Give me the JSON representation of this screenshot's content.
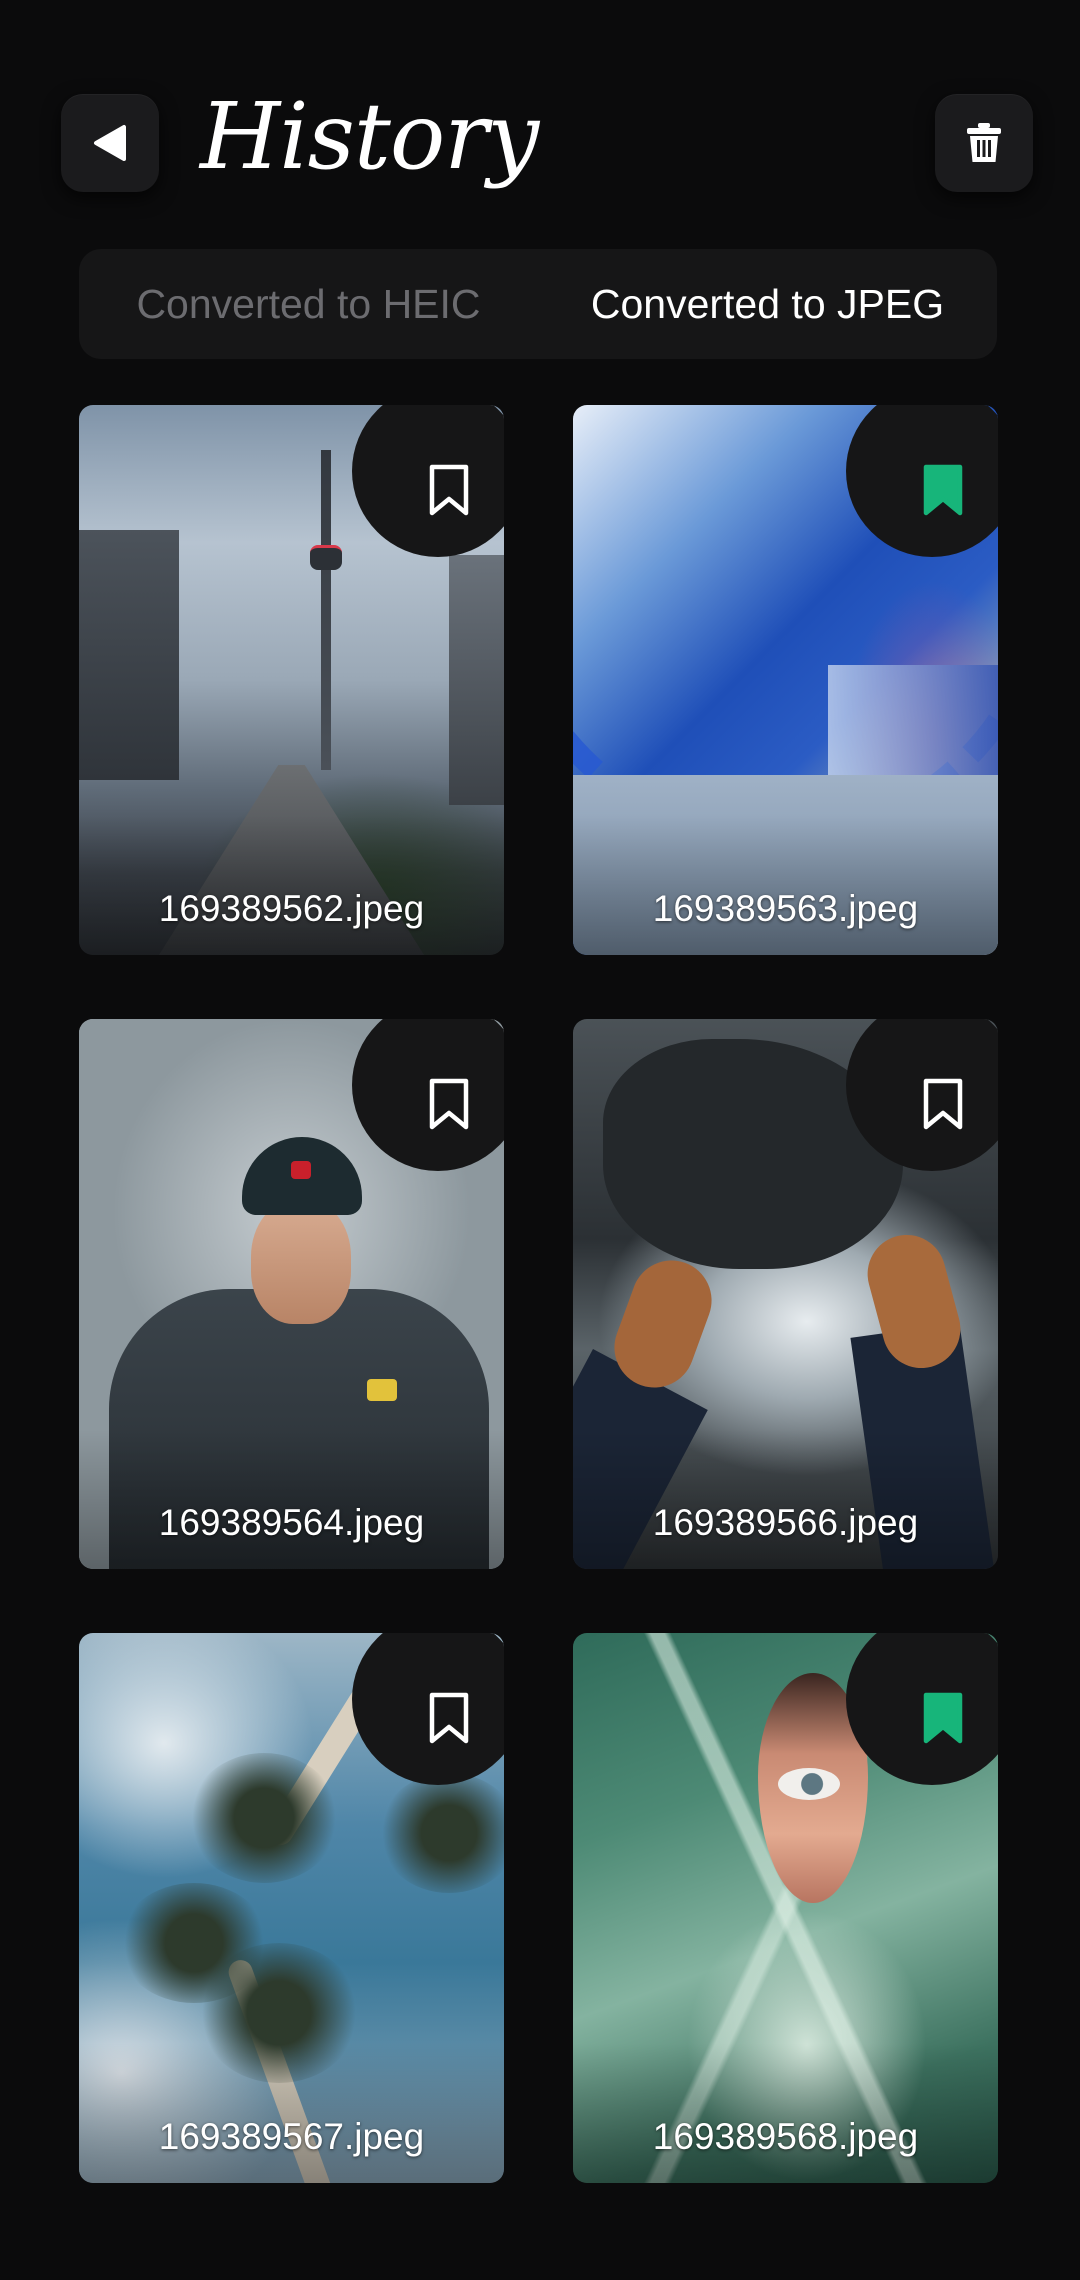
{
  "header": {
    "title": "History",
    "back_icon": "back-arrow-icon",
    "delete_icon": "trash-icon"
  },
  "tabs": [
    {
      "label": "Converted to HEIC",
      "active": false
    },
    {
      "label": "Converted to JPEG",
      "active": true
    }
  ],
  "colors": {
    "background": "#0b0b0c",
    "surface": "#1b1b1d",
    "bookmark_active": "#17b57a",
    "bookmark_inactive": "#ffffff",
    "tab_inactive_text": "#6c6c70"
  },
  "images": [
    {
      "filename": "169389562.jpeg",
      "bookmarked": false
    },
    {
      "filename": "169389563.jpeg",
      "bookmarked": true
    },
    {
      "filename": "169389564.jpeg",
      "bookmarked": false
    },
    {
      "filename": "169389566.jpeg",
      "bookmarked": false
    },
    {
      "filename": "169389567.jpeg",
      "bookmarked": false
    },
    {
      "filename": "169389568.jpeg",
      "bookmarked": true
    }
  ]
}
